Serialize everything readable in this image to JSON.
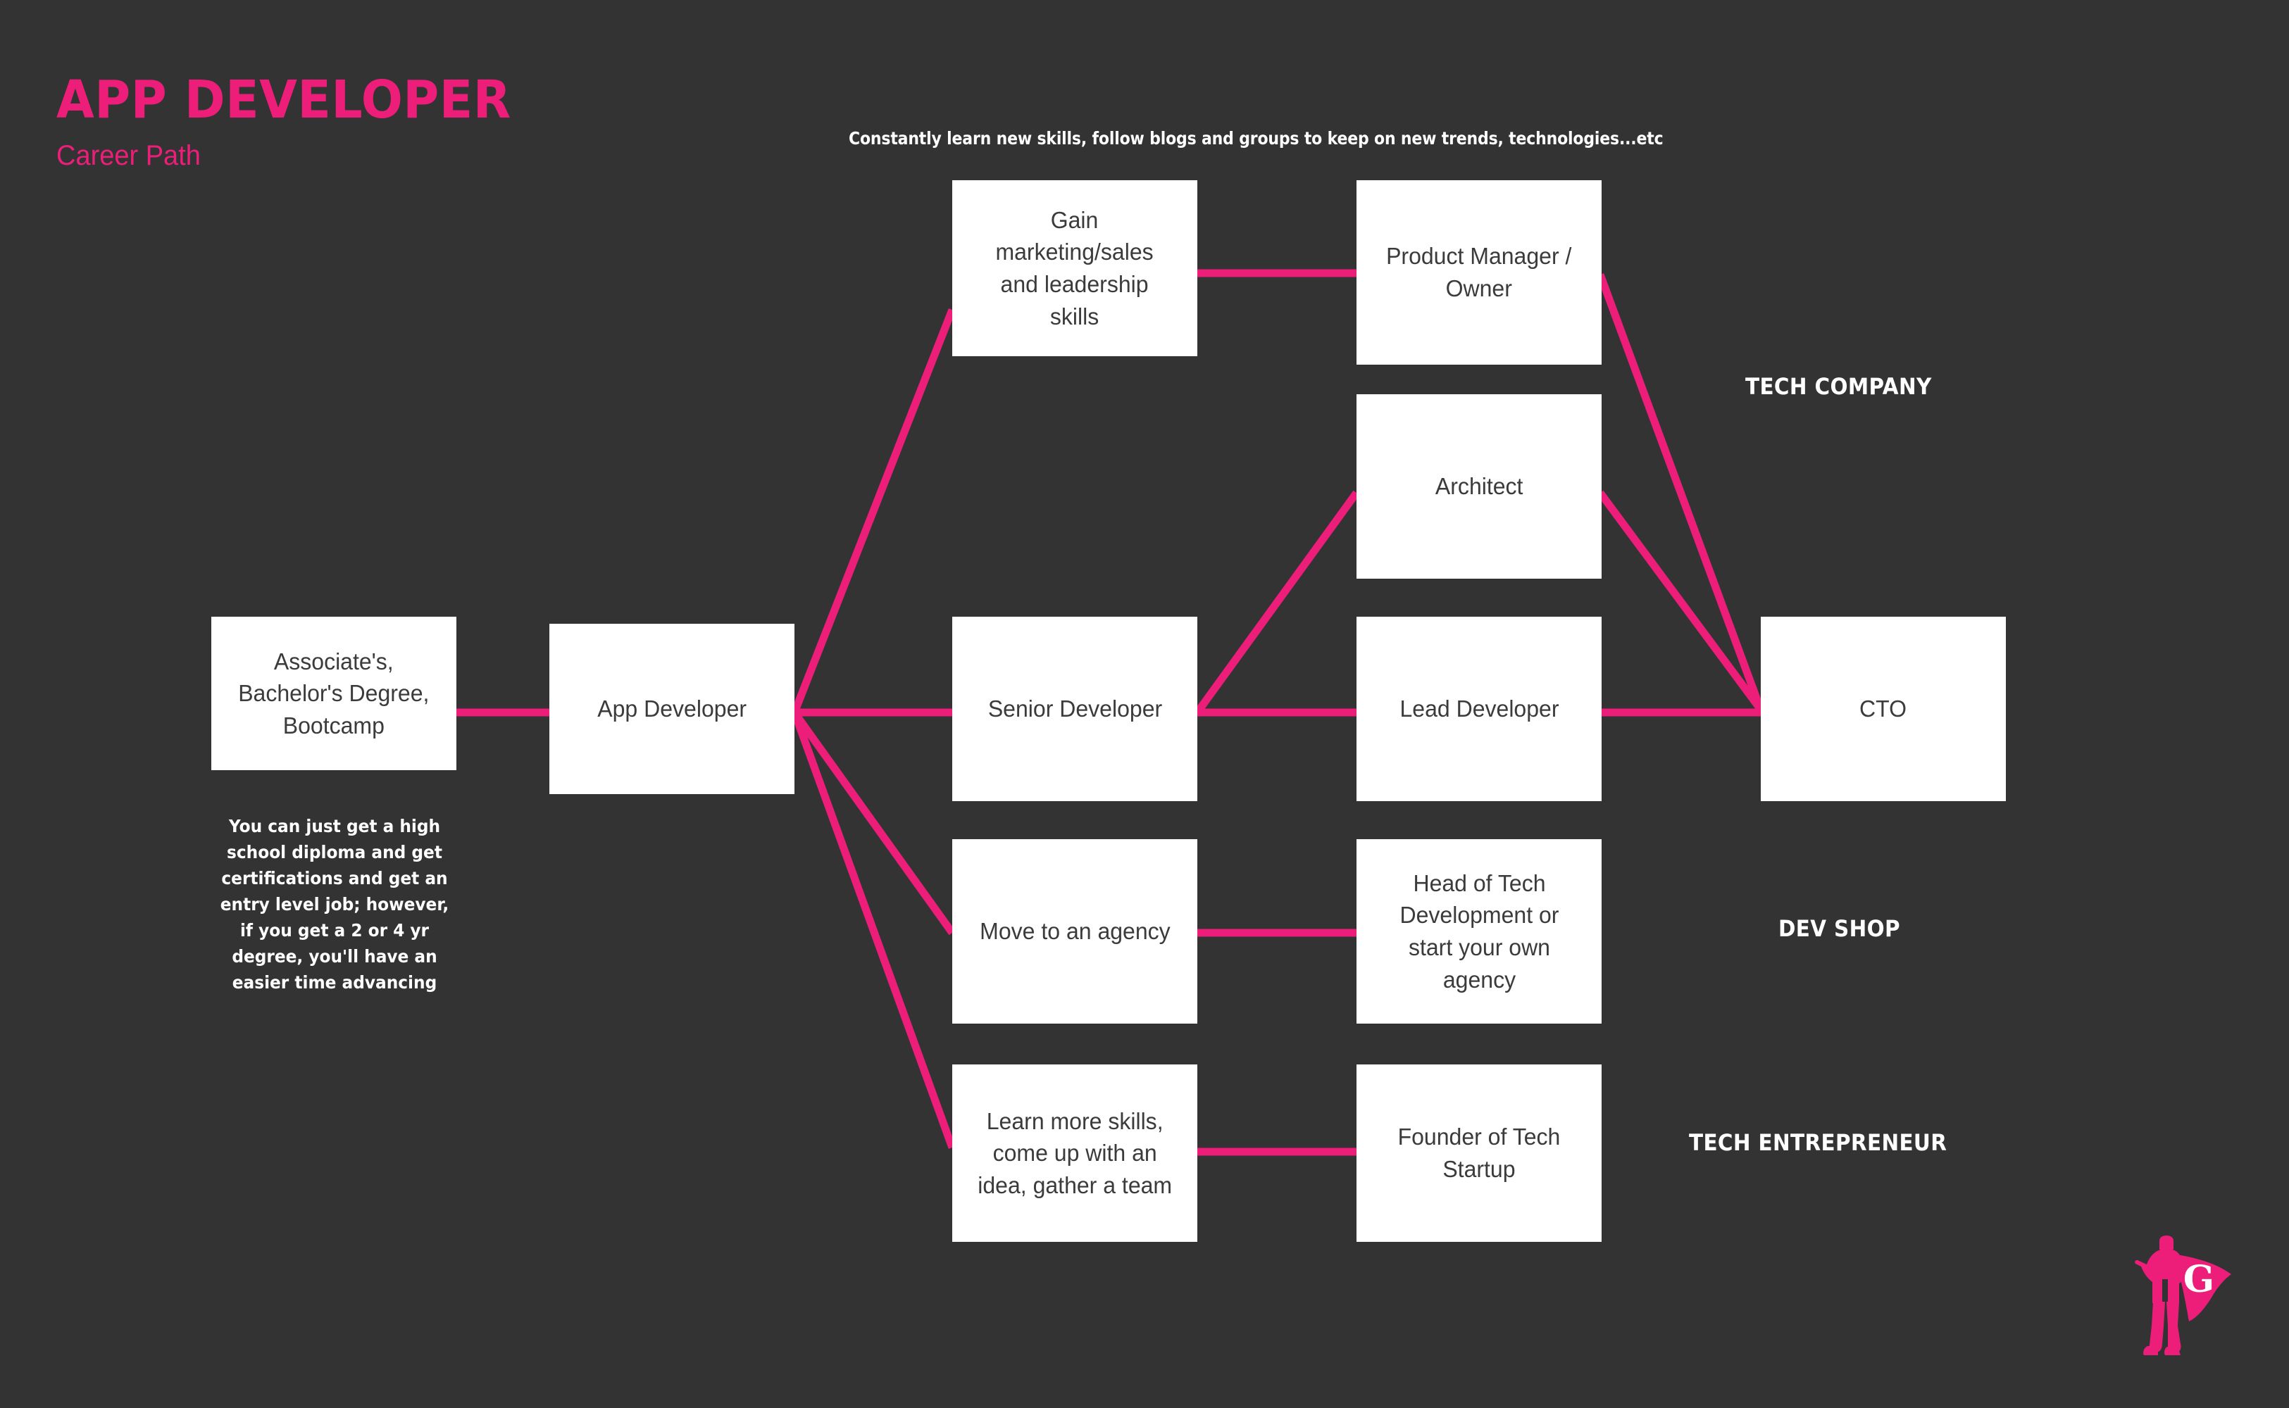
{
  "header": {
    "title": "APP DEVELOPER",
    "subtitle": "Career Path",
    "top_note": "Constantly learn new skills, follow blogs and groups to keep on new trends, technologies...etc"
  },
  "colors": {
    "background": "#333333",
    "accent_pink": "#ED1E79",
    "node_fill": "#ffffff",
    "node_text": "#3b3b3b",
    "caption_text": "#ffffff"
  },
  "nodes": {
    "education": "Associate's,\nBachelor's Degree,\nBootcamp",
    "app_developer": "App Developer",
    "gain_skills": "Gain\nmarketing/sales\nand leadership\nskills",
    "product_manager": "Product Manager /\nOwner",
    "architect": "Architect",
    "senior_developer": "Senior Developer",
    "lead_developer": "Lead Developer",
    "cto": "CTO",
    "move_agency": "Move to an agency",
    "head_of_tech": "Head of Tech\nDevelopment or\nstart your own\nagency",
    "learn_more_skills": "Learn more skills,\ncome up with an\nidea, gather a team",
    "founder_startup": "Founder of Tech\nStartup"
  },
  "captions": {
    "education_note": "You can just  get a high\nschool diploma and get\ncertifications and get an\nentry level job; however,\nif you get a 2 or 4 yr\ndegree, you'll have an\neasier time advancing"
  },
  "tracks": [
    {
      "label": "TECH COMPANY"
    },
    {
      "label": "DEV SHOP"
    },
    {
      "label": "TECH ENTREPRENEUR"
    }
  ],
  "logo": {
    "letter": "G",
    "name": "superhero-logo"
  },
  "chart_data": {
    "type": "diagram",
    "title": "APP DEVELOPER Career Path",
    "nodes": [
      {
        "id": "education",
        "label": "Associate's, Bachelor's Degree, Bootcamp",
        "column": 0,
        "row": "middle"
      },
      {
        "id": "app_developer",
        "label": "App Developer",
        "column": 1,
        "row": "middle"
      },
      {
        "id": "gain_skills",
        "label": "Gain marketing/sales and leadership skills",
        "column": 2,
        "row": "top"
      },
      {
        "id": "product_manager",
        "label": "Product Manager / Owner",
        "column": 3,
        "row": "top"
      },
      {
        "id": "architect",
        "label": "Architect",
        "column": 3,
        "row": "upper-middle"
      },
      {
        "id": "senior_developer",
        "label": "Senior Developer",
        "column": 2,
        "row": "middle"
      },
      {
        "id": "lead_developer",
        "label": "Lead Developer",
        "column": 3,
        "row": "middle"
      },
      {
        "id": "cto",
        "label": "CTO",
        "column": 4,
        "row": "middle"
      },
      {
        "id": "move_agency",
        "label": "Move to an agency",
        "column": 2,
        "row": "lower"
      },
      {
        "id": "head_of_tech",
        "label": "Head of Tech Development or start your own agency",
        "column": 3,
        "row": "lower"
      },
      {
        "id": "learn_more_skills",
        "label": "Learn more skills, come up with an idea, gather a team",
        "column": 2,
        "row": "bottom"
      },
      {
        "id": "founder_startup",
        "label": "Founder of Tech Startup",
        "column": 3,
        "row": "bottom"
      }
    ],
    "edges": [
      {
        "from": "education",
        "to": "app_developer"
      },
      {
        "from": "app_developer",
        "to": "gain_skills"
      },
      {
        "from": "app_developer",
        "to": "senior_developer"
      },
      {
        "from": "app_developer",
        "to": "move_agency"
      },
      {
        "from": "app_developer",
        "to": "learn_more_skills"
      },
      {
        "from": "gain_skills",
        "to": "product_manager"
      },
      {
        "from": "product_manager",
        "to": "cto"
      },
      {
        "from": "senior_developer",
        "to": "architect"
      },
      {
        "from": "senior_developer",
        "to": "lead_developer"
      },
      {
        "from": "architect",
        "to": "cto"
      },
      {
        "from": "lead_developer",
        "to": "cto"
      },
      {
        "from": "move_agency",
        "to": "head_of_tech"
      },
      {
        "from": "learn_more_skills",
        "to": "founder_startup"
      }
    ],
    "track_labels": [
      "TECH COMPANY",
      "DEV SHOP",
      "TECH ENTREPRENEUR"
    ]
  }
}
